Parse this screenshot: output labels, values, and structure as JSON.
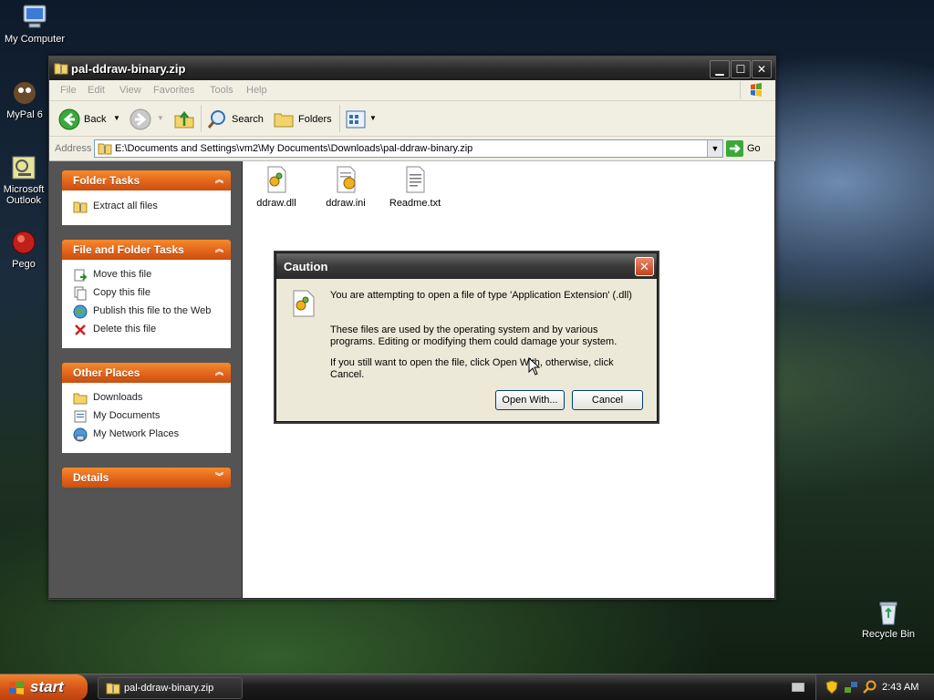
{
  "desktop": {
    "icons": [
      {
        "label": "My Computer"
      },
      {
        "label": "MyPal 6"
      },
      {
        "label": "Microsoft Outlook"
      },
      {
        "label": "Pego"
      },
      {
        "label": "Recycle Bin"
      }
    ]
  },
  "window": {
    "title": "pal-ddraw-binary.zip",
    "menu": [
      "File",
      "Edit",
      "View",
      "Favorites",
      "Tools",
      "Help"
    ],
    "toolbar": {
      "back_label": "Back",
      "search_label": "Search",
      "folders_label": "Folders"
    },
    "address": {
      "label": "Address",
      "path": "E:\\Documents and Settings\\vm2\\My Documents\\Downloads\\pal-ddraw-binary.zip",
      "go_label": "Go"
    },
    "task_pane": {
      "folder_tasks": {
        "title": "Folder Tasks",
        "items": [
          "Extract all files"
        ]
      },
      "file_folder_tasks": {
        "title": "File and Folder Tasks",
        "items": [
          "Move this file",
          "Copy this file",
          "Publish this file to the Web",
          "Delete this file"
        ]
      },
      "other_places": {
        "title": "Other Places",
        "items": [
          "Downloads",
          "My Documents",
          "My Network Places"
        ]
      },
      "details": {
        "title": "Details"
      }
    },
    "files": [
      {
        "name": "ddraw.dll",
        "icon": "dll-icon"
      },
      {
        "name": "ddraw.ini",
        "icon": "ini-icon"
      },
      {
        "name": "Readme.txt",
        "icon": "text-file-icon"
      }
    ]
  },
  "dialog": {
    "title": "Caution",
    "line1": "You are attempting to open a file of type 'Application Extension' (.dll)",
    "para2_line1": "These files are used by the operating system and by various",
    "para2_line2": "programs. Editing or modifying them could damage your system.",
    "para3_line1": "If you still want to open the file, click Open With, otherwise, click",
    "para3_line2": "Cancel.",
    "open_with_label": "Open With...",
    "cancel_label": "Cancel"
  },
  "taskbar": {
    "start_label": "start",
    "task_label": "pal-ddraw-binary.zip",
    "clock": "2:43 AM"
  },
  "colors": {
    "task_header": "#e0621a",
    "dialog_bg": "#ece9d8",
    "pane_bg": "#545454"
  }
}
